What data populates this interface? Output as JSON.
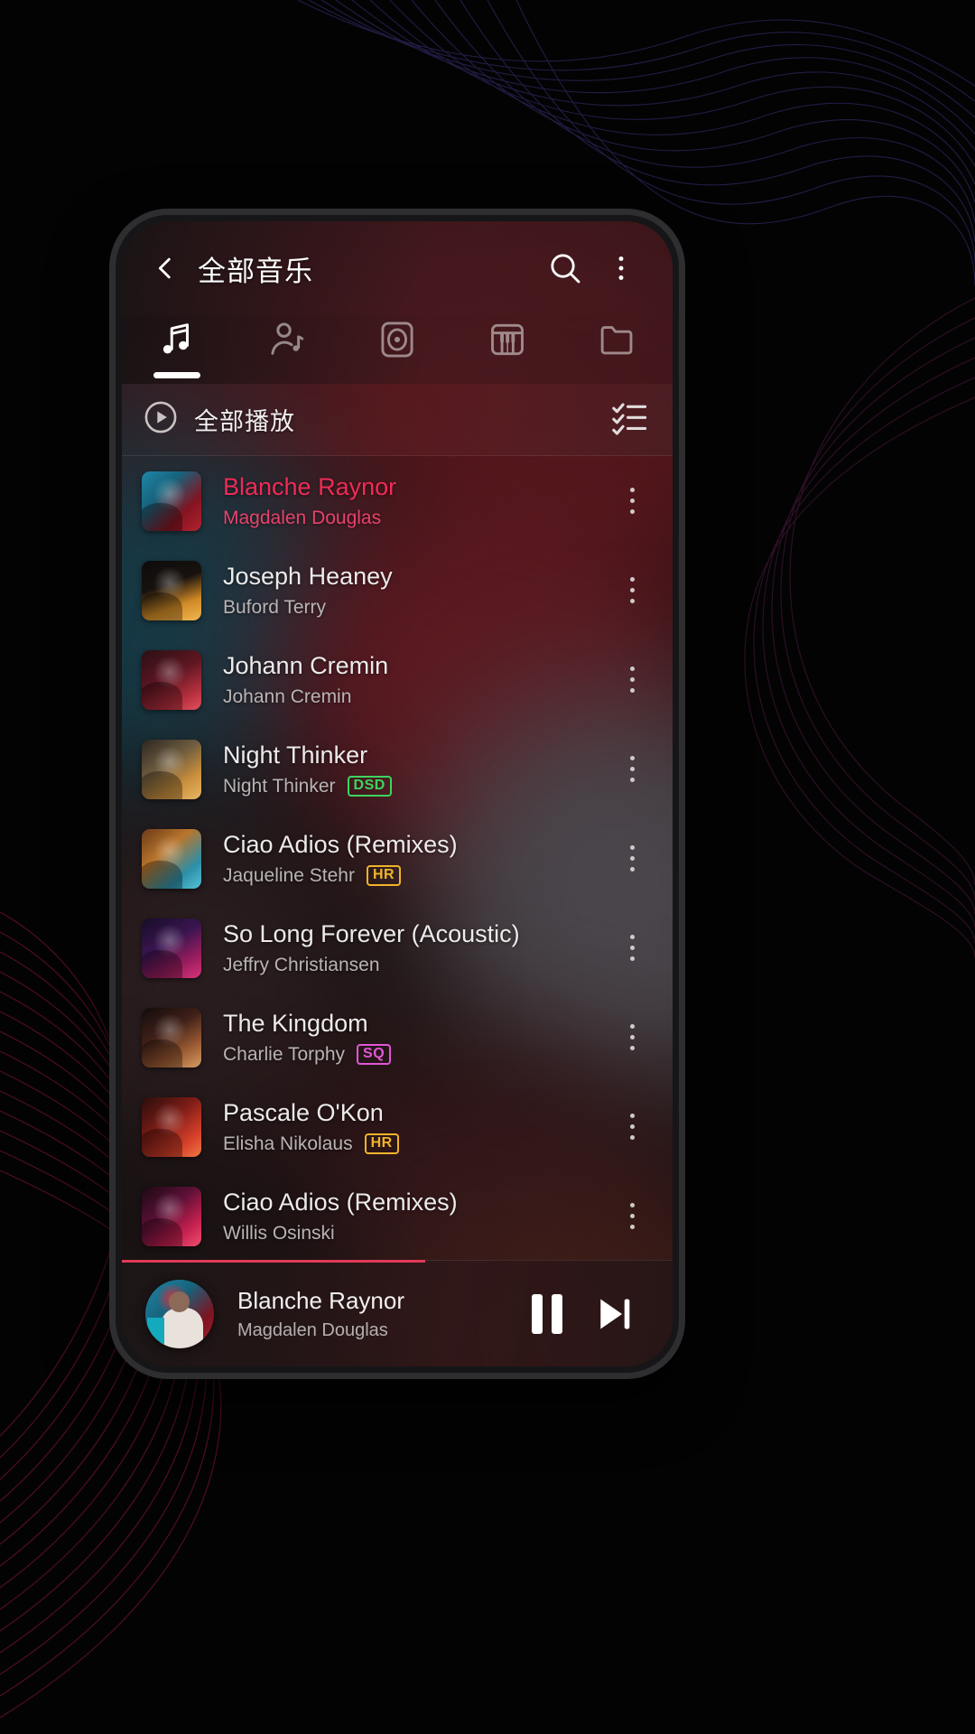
{
  "app": {
    "accent_pink": "#ef2b56",
    "badge_green": "#3dd45e",
    "badge_gold": "#f0b429",
    "badge_magenta": "#e256d8"
  },
  "topbar": {
    "back_icon": "chevron-left-icon",
    "title": "全部音乐",
    "search_icon": "search-icon",
    "overflow_icon": "more-vertical-icon"
  },
  "tabs": [
    {
      "icon": "music-note-icon",
      "name": "songs",
      "active": true
    },
    {
      "icon": "artist-icon",
      "name": "artists",
      "active": false
    },
    {
      "icon": "album-disc-icon",
      "name": "albums",
      "active": false
    },
    {
      "icon": "piano-keys-icon",
      "name": "genres",
      "active": false
    },
    {
      "icon": "folder-icon",
      "name": "folders",
      "active": false
    }
  ],
  "playall": {
    "play_icon": "play-circle-icon",
    "label": "全部播放",
    "select_icon": "checklist-icon"
  },
  "songs": [
    {
      "title": "Blanche Raynor",
      "artist": "Magdalen Douglas",
      "badge": "",
      "playing": true
    },
    {
      "title": "Joseph Heaney",
      "artist": "Buford Terry",
      "badge": "",
      "playing": false
    },
    {
      "title": "Johann Cremin",
      "artist": "Johann Cremin",
      "badge": "",
      "playing": false
    },
    {
      "title": "Night Thinker",
      "artist": "Night Thinker",
      "badge": "DSD",
      "playing": false
    },
    {
      "title": "Ciao Adios (Remixes)",
      "artist": "Jaqueline Stehr",
      "badge": "HR",
      "playing": false
    },
    {
      "title": "So Long Forever (Acoustic)",
      "artist": "Jeffry Christiansen",
      "badge": "",
      "playing": false
    },
    {
      "title": "The Kingdom",
      "artist": "Charlie Torphy",
      "badge": "SQ",
      "playing": false
    },
    {
      "title": "Pascale O'Kon",
      "artist": "Elisha Nikolaus",
      "badge": "HR",
      "playing": false
    },
    {
      "title": "Ciao Adios (Remixes)",
      "artist": "Willis Osinski",
      "badge": "",
      "playing": false
    }
  ],
  "miniplayer": {
    "title": "Blanche Raynor",
    "artist": "Magdalen Douglas",
    "pause_icon": "pause-icon",
    "next_icon": "skip-next-icon"
  }
}
